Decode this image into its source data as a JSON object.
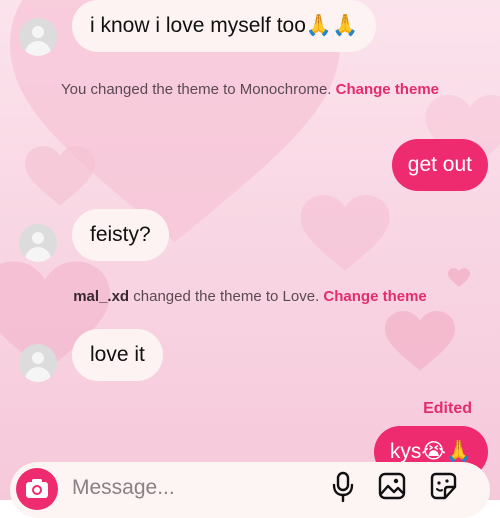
{
  "messages": {
    "msg1": {
      "text": "i know i love myself too",
      "emoji": "🙏🙏"
    },
    "sys1": {
      "text": "You changed the theme to Monochrome.",
      "link": "Change theme"
    },
    "msg2": {
      "text": "get out"
    },
    "msg3": {
      "text": "feisty?"
    },
    "sys2": {
      "user": "mal_.xd",
      "text": "changed the theme to Love.",
      "link": "Change theme"
    },
    "msg4": {
      "text": "love it"
    },
    "edited_label": "Edited",
    "msg5": {
      "text": "kys",
      "emoji": "😭🙏"
    }
  },
  "composer": {
    "placeholder": "Message..."
  },
  "icons": [
    "camera-icon",
    "microphone-icon",
    "image-icon",
    "sticker-icon"
  ],
  "colors": {
    "accent": "#ee2b6f",
    "link": "#e42c6c",
    "incoming_bubble": "#fdf3f2",
    "background": "#f8d4e2"
  }
}
